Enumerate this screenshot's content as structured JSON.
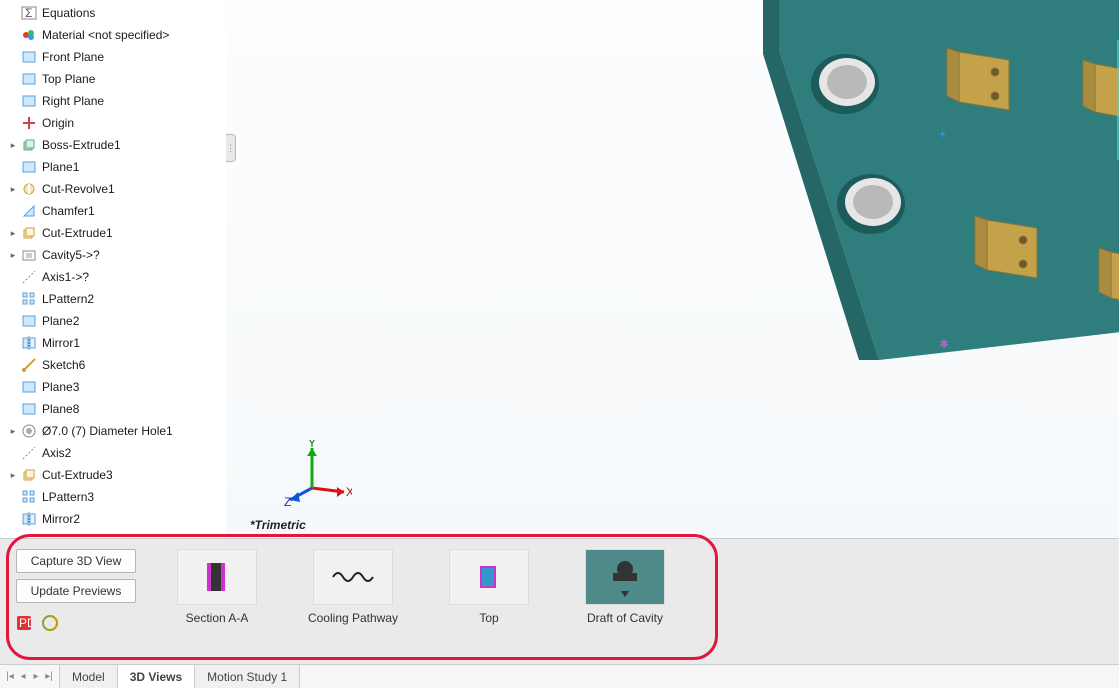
{
  "tree": {
    "items": [
      {
        "label": "Equations",
        "icon": "equations",
        "indent": 0,
        "exp": ""
      },
      {
        "label": "Material <not specified>",
        "icon": "material",
        "indent": 0,
        "exp": ""
      },
      {
        "label": "Front Plane",
        "icon": "plane",
        "indent": 0,
        "exp": ""
      },
      {
        "label": "Top Plane",
        "icon": "plane",
        "indent": 0,
        "exp": ""
      },
      {
        "label": "Right Plane",
        "icon": "plane",
        "indent": 0,
        "exp": ""
      },
      {
        "label": "Origin",
        "icon": "origin",
        "indent": 0,
        "exp": ""
      },
      {
        "label": "Boss-Extrude1",
        "icon": "extrude",
        "indent": 0,
        "exp": "▸"
      },
      {
        "label": "Plane1",
        "icon": "plane",
        "indent": 0,
        "exp": ""
      },
      {
        "label": "Cut-Revolve1",
        "icon": "cutrev",
        "indent": 0,
        "exp": "▸"
      },
      {
        "label": "Chamfer1",
        "icon": "chamfer",
        "indent": 0,
        "exp": ""
      },
      {
        "label": "Cut-Extrude1",
        "icon": "cutext",
        "indent": 0,
        "exp": "▸"
      },
      {
        "label": "Cavity5->?",
        "icon": "cavity",
        "indent": 0,
        "exp": "▸"
      },
      {
        "label": "Axis1->?",
        "icon": "axis",
        "indent": 0,
        "exp": ""
      },
      {
        "label": "LPattern2",
        "icon": "pattern",
        "indent": 0,
        "exp": ""
      },
      {
        "label": "Plane2",
        "icon": "plane",
        "indent": 0,
        "exp": ""
      },
      {
        "label": "Mirror1",
        "icon": "mirror",
        "indent": 0,
        "exp": ""
      },
      {
        "label": "Sketch6",
        "icon": "sketch",
        "indent": 0,
        "exp": ""
      },
      {
        "label": "Plane3",
        "icon": "plane",
        "indent": 0,
        "exp": ""
      },
      {
        "label": "Plane8",
        "icon": "plane",
        "indent": 0,
        "exp": ""
      },
      {
        "label": "Ø7.0 (7) Diameter Hole1",
        "icon": "hole",
        "indent": 0,
        "exp": "▸"
      },
      {
        "label": "Axis2",
        "icon": "axis",
        "indent": 0,
        "exp": ""
      },
      {
        "label": "Cut-Extrude3",
        "icon": "cutext",
        "indent": 0,
        "exp": "▸"
      },
      {
        "label": "LPattern3",
        "icon": "pattern",
        "indent": 0,
        "exp": ""
      },
      {
        "label": "Mirror2",
        "icon": "mirror",
        "indent": 0,
        "exp": ""
      }
    ]
  },
  "triad": {
    "x": "X",
    "y": "Y",
    "z": "Z",
    "label": "*Trimetric"
  },
  "views_panel": {
    "capture_label": "Capture 3D View",
    "update_label": "Update Previews",
    "thumbs": [
      {
        "label": "Section A-A",
        "style": "section"
      },
      {
        "label": "Cooling Pathway",
        "style": "cooling"
      },
      {
        "label": "Top",
        "style": "top"
      },
      {
        "label": "Draft of Cavity",
        "style": "draft"
      }
    ]
  },
  "tabs": {
    "items": [
      {
        "label": "Model",
        "active": false
      },
      {
        "label": "3D Views",
        "active": true
      },
      {
        "label": "Motion Study 1",
        "active": false
      }
    ]
  }
}
